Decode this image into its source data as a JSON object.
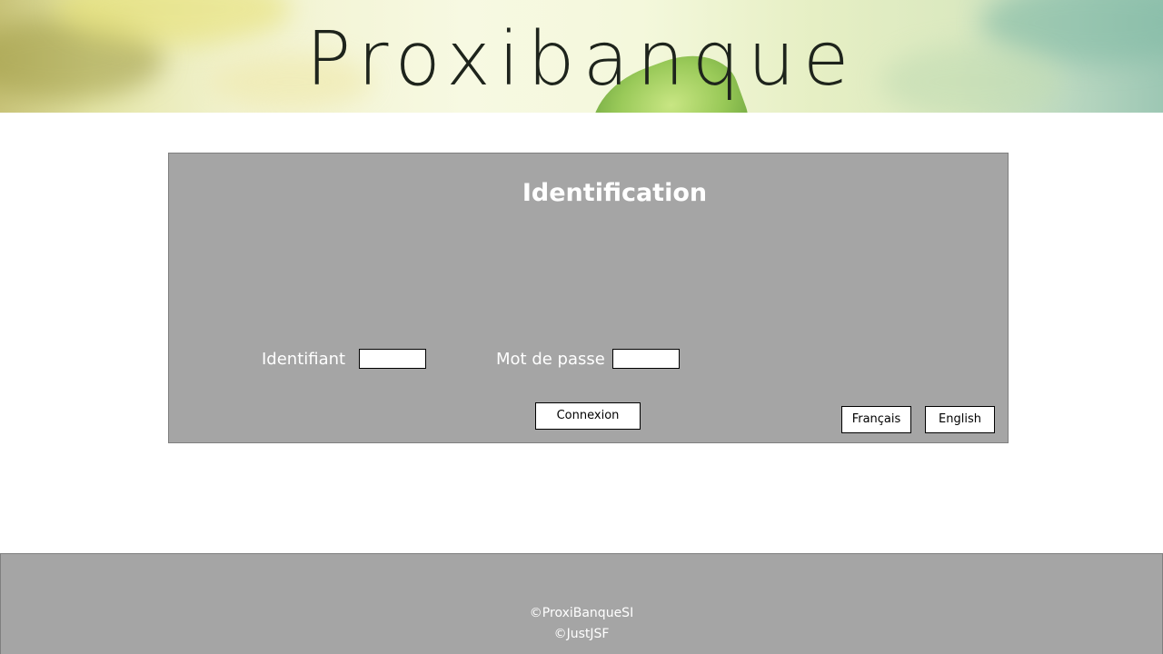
{
  "header": {
    "logo_text": "Proxibanque"
  },
  "login": {
    "title": "Identification",
    "username_label": "Identifiant",
    "username_value": "",
    "password_label": "Mot de passe",
    "password_value": "",
    "submit_label": "Connexion"
  },
  "language": {
    "french_label": "Français",
    "english_label": "English"
  },
  "footer": {
    "copyright_company": "©ProxiBanqueSI",
    "copyright_framework": "©JustJSF"
  },
  "colors": {
    "panel_background": "#a5a5a5",
    "panel_border": "#7f7f7f",
    "text_on_panel": "#ffffff",
    "button_background": "#ffffff"
  }
}
